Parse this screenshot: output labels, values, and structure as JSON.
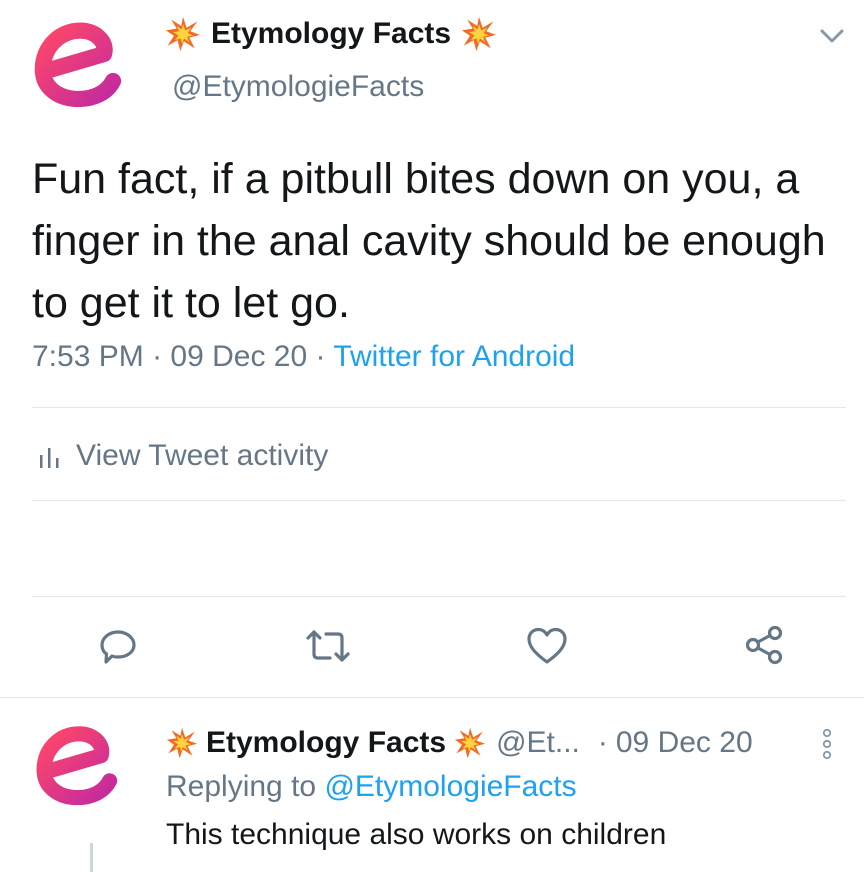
{
  "main_tweet": {
    "display_name": "Etymology Facts",
    "name_prefix_icon": "collision-icon",
    "name_suffix_icon": "collision-icon",
    "handle": "@EtymologieFacts",
    "text": "Fun fact, if a pitbull bites down on you, a finger in the anal cavity should be enough to get it to let go.",
    "time": "7:53 PM",
    "separator": "·",
    "date": "09 Dec 20",
    "source": "Twitter for Android",
    "activity_label": "View Tweet activity",
    "menu_icon": "chevron-down-icon"
  },
  "actions": [
    {
      "name": "reply",
      "icon": "reply-icon"
    },
    {
      "name": "retweet",
      "icon": "retweet-icon"
    },
    {
      "name": "like",
      "icon": "heart-icon"
    },
    {
      "name": "share",
      "icon": "share-icon"
    }
  ],
  "reply_tweet": {
    "display_name": "Etymology Facts",
    "handle": "@Et...",
    "separator": "·",
    "date": "09 Dec 20",
    "replying_prefix": "Replying to",
    "replying_handle": "@EtymologieFacts",
    "text": "This technique also works on children",
    "menu_icon": "more-vertical-icon"
  },
  "colors": {
    "accent": "#1da1f2",
    "muted": "#657786",
    "text": "#14171a",
    "divider": "#e1e8ed",
    "logo_gradient_start": "#ff3d74",
    "logo_gradient_end": "#c82a9a"
  }
}
